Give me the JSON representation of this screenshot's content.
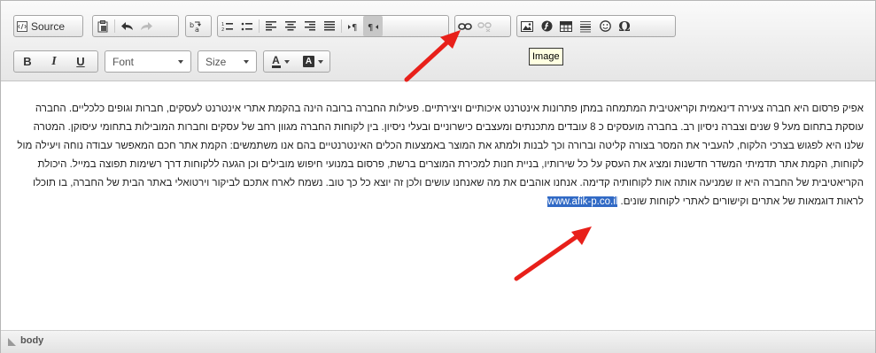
{
  "toolbar": {
    "source_label": "Source",
    "font_label": "Font",
    "size_label": "Size",
    "bold_label": "B",
    "italic_label": "I",
    "underline_label": "U",
    "text_color_label": "A",
    "bg_color_label": "A",
    "special_char_label": "Ω",
    "tooltip": "Image"
  },
  "content": {
    "text": "אפיק פרסום היא חברה צעירה דינאמית וקריאטיבית המתמחה במתן פתרונות אינטרנט איכותיים ויצירתיים. פעילות החברה ברובה הינה בהקמת אתרי אינטרנט לעסקים, חברות וגופים כלכליים. החברה עוסקת בתחום מעל 9 שנים וצברה ניסיון רב. בחברה מועסקים כ 8 עובדים מתכנתים ומעצבים כישרוניים ובעלי ניסיון. בין לקוחות החברה מגוון רחב של עסקים וחברות המובילות בתחומי עיסוקן. המטרה שלנו היא לפגוש בצרכי הלקוח, להעביר את המסר בצורה קליטה וברורה וכך לבנות ולמתג את המוצר באמצעות הכלים האינטרנטיים בהם אנו משתמשים: הקמת אתר חכם המאפשר עבודה נוחה ויעילה מול לקוחות, הקמת אתר תדמיתי המשדר חדשנות ומציג את העסק על כל שירותיו, בניית חנות למכירת המוצרים ברשת, פרסום במנועי חיפוש מובילים וכן הגעה ללקוחות דרך רשימות תפוצה במייל. היכולת הקריאטיבית של החברה היא זו שמניעה אותה אות לקוחותיה קדימה. אנחנו אוהבים את מה שאנחנו עושים ולכן זה יוצא כל כך טוב. נשמח לארח אתכם לביקור וירטואלי באתר הבית של החברה, בו תוכלו לראות דוגמאות של אתרים וקישורים לאתרי לקוחות שונים.",
    "link": "www.afik-p.co.il"
  },
  "status": {
    "path": "body"
  },
  "colors": {
    "selection": "#316ac5",
    "arrow": "#e8201a",
    "tooltip_bg": "#ffffe1"
  }
}
